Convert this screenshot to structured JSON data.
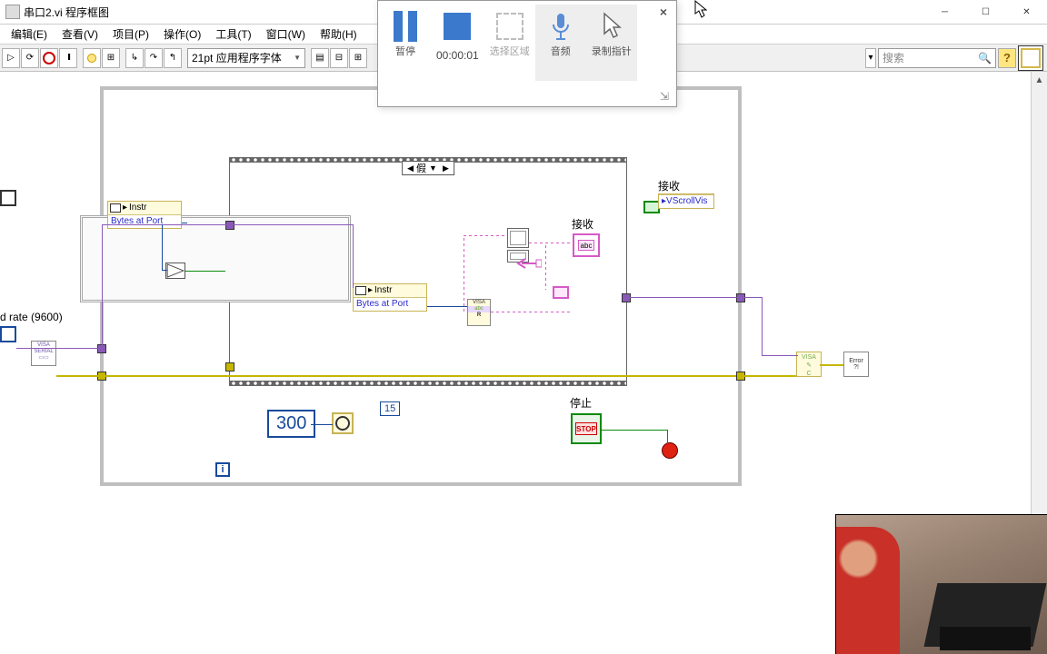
{
  "window": {
    "title": "串口2.vi 程序框图"
  },
  "menu": {
    "edit": "编辑(E)",
    "view": "查看(V)",
    "project": "项目(P)",
    "operate": "操作(O)",
    "tools": "工具(T)",
    "window": "窗口(W)",
    "help": "帮助(H)"
  },
  "toolbar": {
    "font": "21pt 应用程序字体",
    "search_placeholder": "搜索"
  },
  "recorder": {
    "pause": "暂停",
    "time": "00:00:01",
    "area": "选择区域",
    "audio": "音频",
    "pointer": "录制指针"
  },
  "diagram": {
    "case_selector": "假",
    "instr1": "Instr",
    "bytes1": "Bytes at Port",
    "instr2": "Instr",
    "bytes2": "Bytes at Port",
    "baud_label": "d rate (9600)",
    "recv_label": "接收",
    "recv_indicator": "接收",
    "vscroll": "VScrollVis",
    "stop_label": "停止",
    "const_300": "300",
    "const_15": "15",
    "visa_read": "VISA",
    "visa_abc": "abc",
    "visa_r": "R",
    "stop_btn": "STOP",
    "err": "Error",
    "abc": "abc"
  }
}
